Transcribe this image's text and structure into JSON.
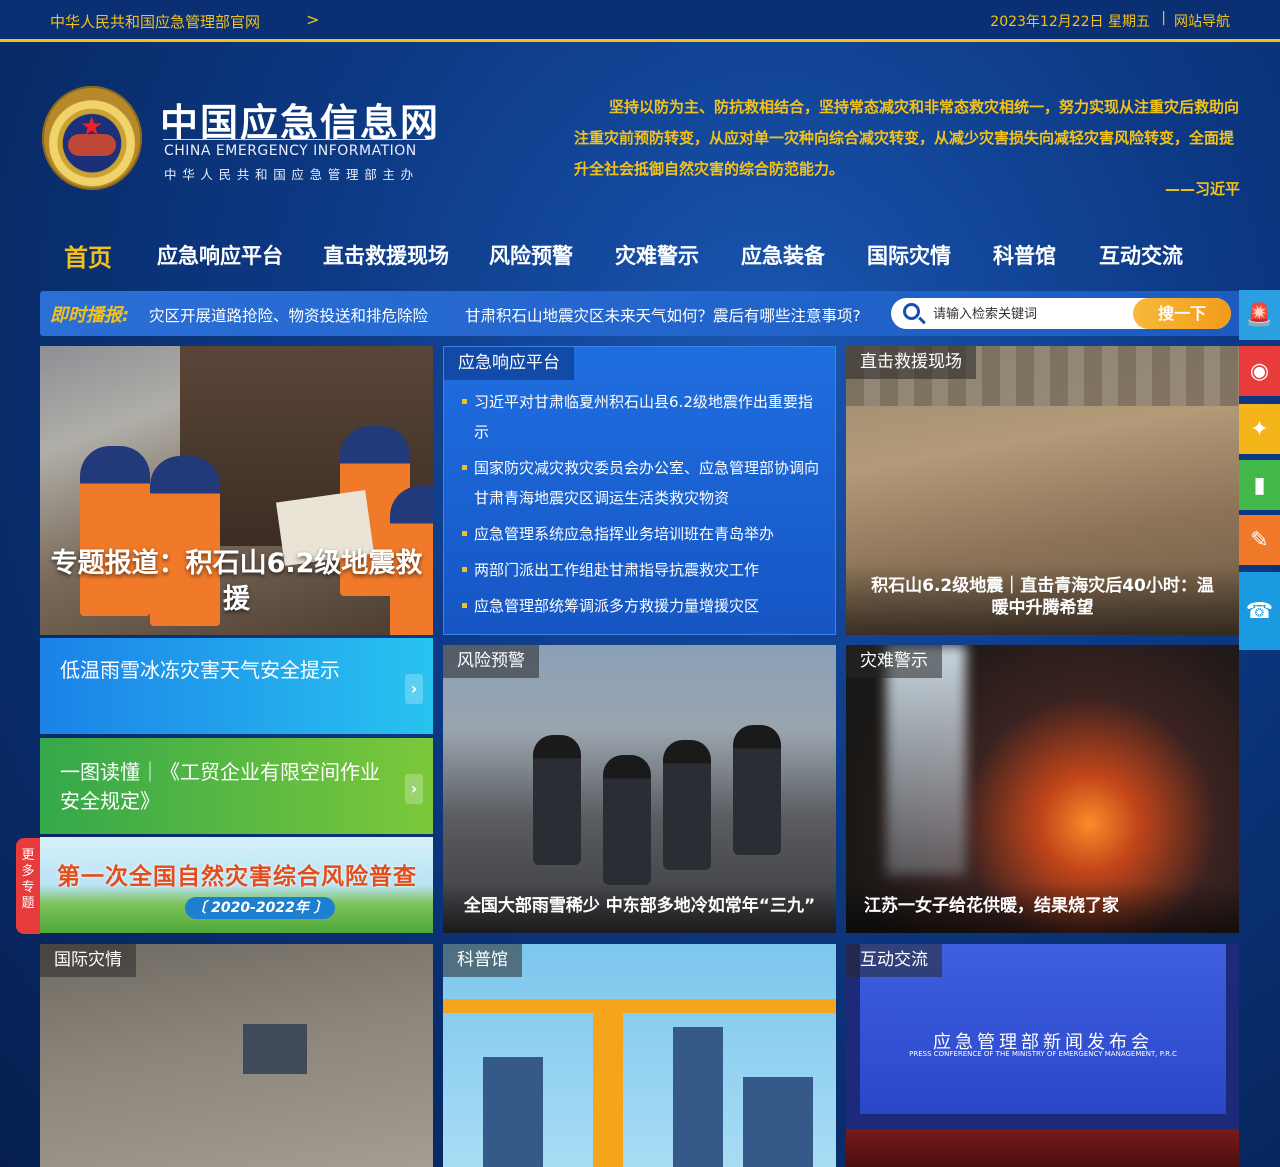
{
  "topbar": {
    "site_link": "中华人民共和国应急管理部官网",
    "date": "2023年12月22日 星期五",
    "separator": "|",
    "sitemap": "网站导航"
  },
  "header": {
    "brand_cn": "中国应急信息网",
    "brand_en": "CHINA EMERGENCY INFORMATION",
    "brand_sub": "中华人民共和国应急管理部主办",
    "motto": "坚持以防为主、防抗救相结合，坚持常态减灾和非常态救灾相统一，努力实现从注重灾后救助向注重灾前预防转变，从应对单一灾种向综合减灾转变，从减少灾害损失向减轻灾害风险转变，全面提升全社会抵御自然灾害的综合防范能力。",
    "motto_author": "——习近平"
  },
  "nav": {
    "items": [
      {
        "label": "首页"
      },
      {
        "label": "应急响应平台"
      },
      {
        "label": "直击救援现场"
      },
      {
        "label": "风险预警"
      },
      {
        "label": "灾难警示"
      },
      {
        "label": "应急装备"
      },
      {
        "label": "国际灾情"
      },
      {
        "label": "科普馆"
      },
      {
        "label": "互动交流"
      }
    ]
  },
  "flash": {
    "label": "即时播报:",
    "news": [
      "灾区开展道路抢险、物资投送和排危除险",
      "甘肃积石山地震灾区未来天气如何？震后有哪些注意事项?"
    ]
  },
  "search": {
    "placeholder": "请输入检索关键词",
    "button": "搜一下"
  },
  "feature": {
    "caption": "专题报道：积石山6.2级地震救援"
  },
  "response_panel": {
    "tag": "应急响应平台",
    "items": [
      "习近平对甘肃临夏州积石山县6.2级地震作出重要指示",
      "国家防灾减灾救灾委员会办公室、应急管理部协调向甘肃青海地震灾区调运生活类救灾物资",
      "应急管理系统应急指挥业务培训班在青岛举办",
      "两部门派出工作组赴甘肃指导抗震救灾工作",
      "应急管理部统筹调派多方救援力量增援灾区"
    ]
  },
  "rescue_panel": {
    "tag": "直击救援现场",
    "caption": "积石山6.2级地震｜直击青海灾后40小时：温暖中升腾希望"
  },
  "promos": {
    "blue": "低温雨雪冰冻灾害天气安全提示",
    "green": "一图读懂｜《工贸企业有限空间作业安全规定》",
    "banner_title": "第一次全国自然灾害综合风险普查",
    "banner_years": "〔 2020-2022年 〕",
    "arrow": "›"
  },
  "risk_panel": {
    "tag": "风险预警",
    "caption": "全国大部雨雪稀少 中东部多地冷如常年“三九”"
  },
  "disaster_panel": {
    "tag": "灾难警示",
    "caption": "江苏一女子给花供暖，结果烧了家"
  },
  "intl_panel": {
    "tag": "国际灾情"
  },
  "sci_panel": {
    "tag": "科普馆"
  },
  "conf_panel": {
    "tag": "互动交流",
    "screen_title": "应急管理部新闻发布会",
    "screen_en": "PRESS CONFERENCE OF THE MINISTRY OF EMERGENCY MANAGEMENT, P.R.C"
  },
  "more_topics": "更多专题",
  "side_buttons": [
    {
      "name": "alarm-icon",
      "color": "#2aa0e0",
      "glyph": "🚨"
    },
    {
      "name": "weibo-icon",
      "color": "#e83b3b",
      "glyph": "◉"
    },
    {
      "name": "badge-icon",
      "color": "#f3b51a",
      "glyph": "✦"
    },
    {
      "name": "extinguisher-icon",
      "color": "#43b84a",
      "glyph": "▮"
    },
    {
      "name": "pen-icon",
      "color": "#f07a2a",
      "glyph": "✎"
    },
    {
      "name": "phone-icon",
      "color": "#1a9ae0",
      "glyph": "☎"
    }
  ],
  "colors": {
    "accent": "#f3c21a",
    "background": "#0d3a86"
  }
}
